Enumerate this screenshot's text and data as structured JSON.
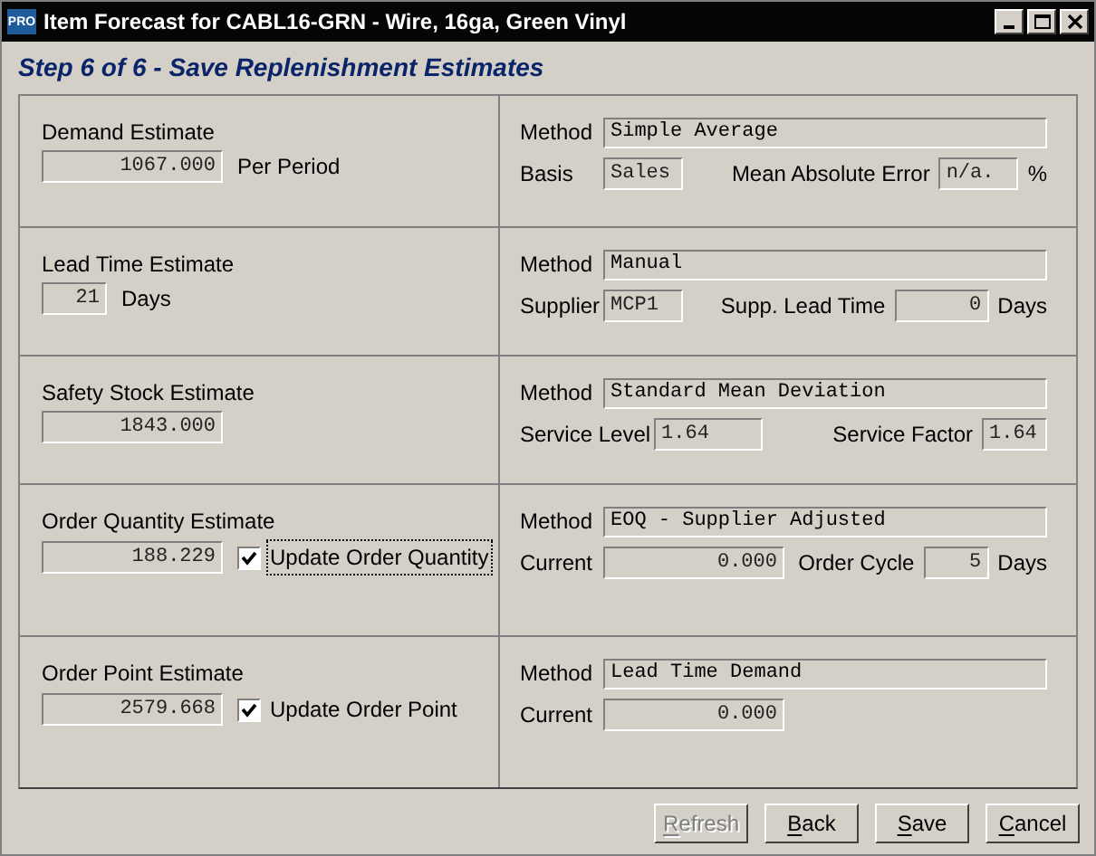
{
  "window": {
    "icon": "PRO",
    "title": "Item Forecast for CABL16-GRN - Wire, 16ga, Green Vinyl"
  },
  "heading": "Step 6 of 6 - Save Replenishment Estimates",
  "sections": [
    {
      "estimate": {
        "label": "Demand Estimate",
        "value": "1067.000",
        "unit": "Per Period"
      },
      "method": {
        "label": "Method",
        "value": "Simple Average"
      },
      "line": {
        "left": [
          {
            "kind": "label",
            "text": "Basis"
          },
          {
            "kind": "field",
            "value": "Sales"
          }
        ],
        "right": [
          {
            "kind": "label",
            "text": "Mean Absolute Error"
          },
          {
            "kind": "field",
            "value": "n/a."
          },
          {
            "kind": "label",
            "text": "%"
          }
        ]
      }
    },
    {
      "estimate": {
        "label": "Lead Time Estimate",
        "value": "21",
        "unit": "Days"
      },
      "method": {
        "label": "Method",
        "value": "Manual"
      },
      "line": {
        "left": [
          {
            "kind": "label",
            "text": "Supplier"
          },
          {
            "kind": "field",
            "value": "MCP1"
          }
        ],
        "right": [
          {
            "kind": "label",
            "text": "Supp. Lead Time"
          },
          {
            "kind": "field",
            "value": "0"
          },
          {
            "kind": "label",
            "text": "Days"
          }
        ]
      }
    },
    {
      "estimate": {
        "label": "Safety Stock Estimate",
        "value": "1843.000"
      },
      "method": {
        "label": "Method",
        "value": "Standard Mean Deviation"
      },
      "line": {
        "left": [
          {
            "kind": "label",
            "text": "Service Level"
          },
          {
            "kind": "field",
            "value": "1.64"
          }
        ],
        "right": [
          {
            "kind": "label",
            "text": "Service Factor"
          },
          {
            "kind": "field",
            "value": "1.64"
          }
        ]
      }
    },
    {
      "estimate": {
        "label": "Order Quantity Estimate",
        "value": "188.229",
        "checkbox": {
          "label": "Update Order Quantity",
          "checked": true,
          "focused": true
        }
      },
      "method": {
        "label": "Method",
        "value": "EOQ - Supplier Adjusted"
      },
      "line": {
        "left": [
          {
            "kind": "label",
            "text": "Current"
          },
          {
            "kind": "field",
            "value": "0.000"
          }
        ],
        "right": [
          {
            "kind": "label",
            "text": "Order Cycle"
          },
          {
            "kind": "field",
            "value": "5"
          },
          {
            "kind": "label",
            "text": "Days"
          }
        ]
      }
    },
    {
      "estimate": {
        "label": "Order Point Estimate",
        "value": "2579.668",
        "checkbox": {
          "label": "Update Order Point",
          "checked": true,
          "focused": false
        }
      },
      "method": {
        "label": "Method",
        "value": "Lead Time Demand"
      },
      "line": {
        "left": [
          {
            "kind": "label",
            "text": "Current"
          },
          {
            "kind": "field",
            "value": "0.000"
          }
        ]
      }
    }
  ],
  "buttons": [
    {
      "label": "Refresh",
      "disabled": true
    },
    {
      "label": "Back",
      "disabled": false
    },
    {
      "label": "Save",
      "disabled": false
    },
    {
      "label": "Cancel",
      "disabled": false
    }
  ]
}
